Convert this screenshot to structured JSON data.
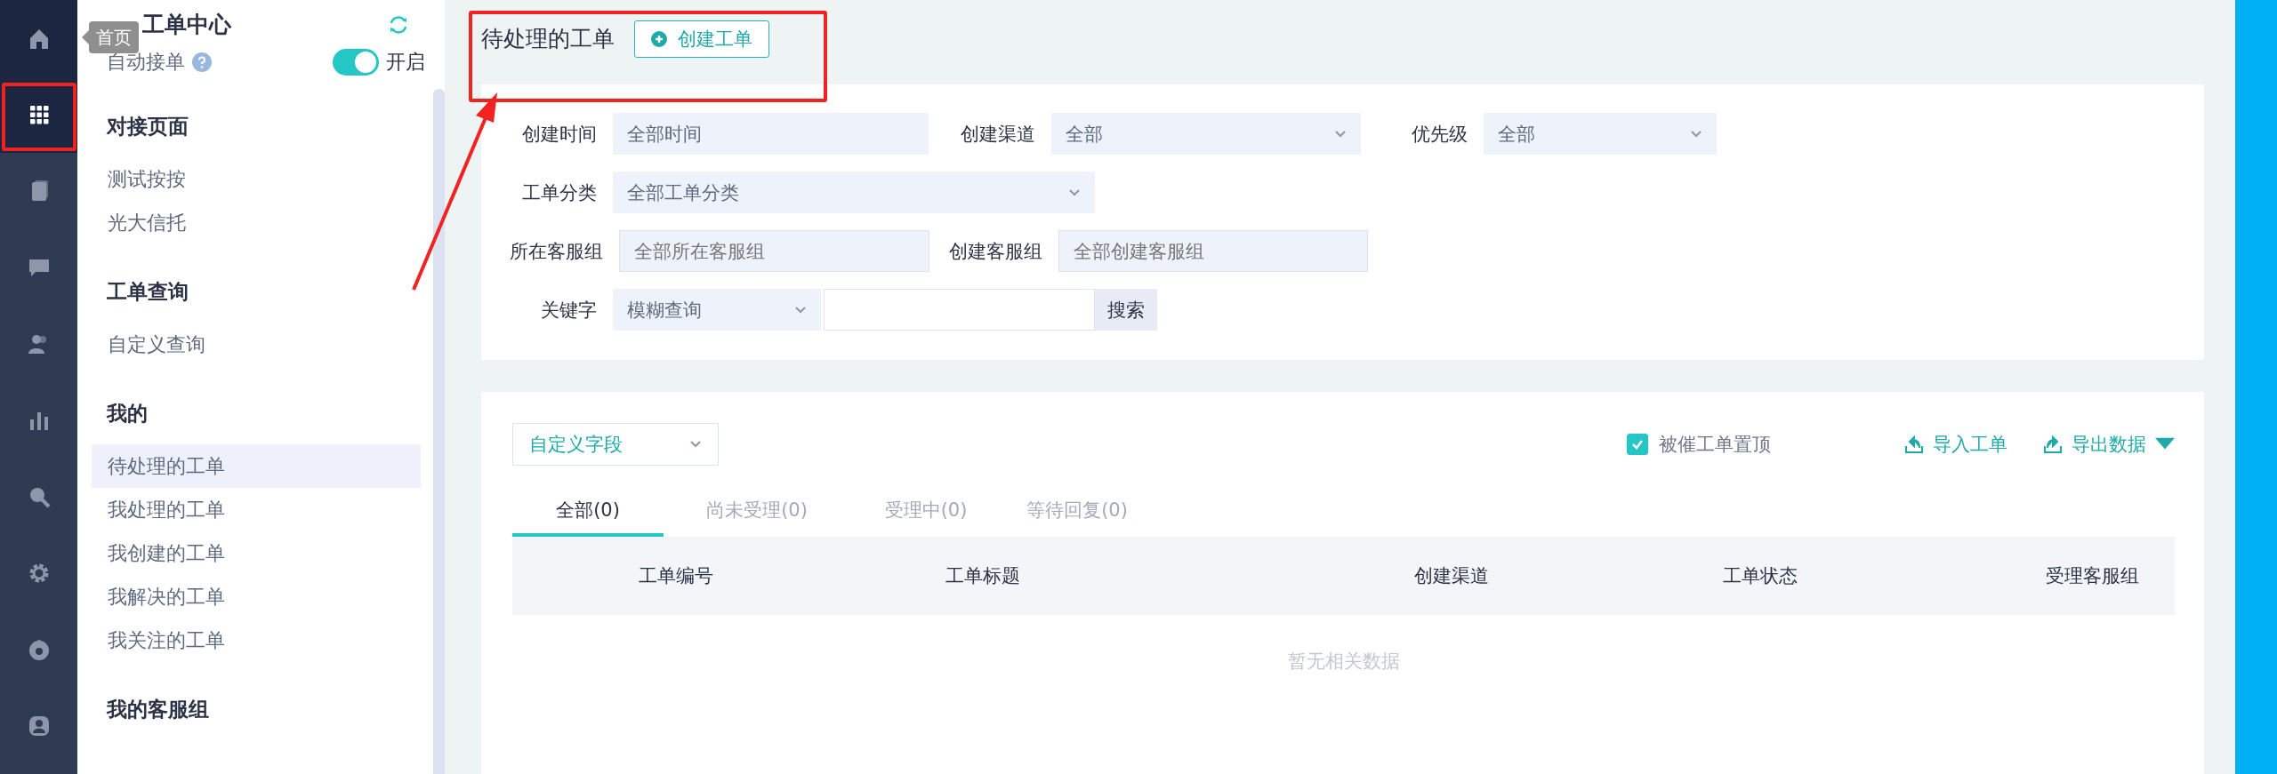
{
  "nav": {
    "items": [
      {
        "kind": "home",
        "selected": false
      },
      {
        "kind": "grid",
        "selected": true
      },
      {
        "kind": "book",
        "selected": false
      },
      {
        "kind": "chat",
        "selected": false
      },
      {
        "kind": "users",
        "selected": false
      },
      {
        "kind": "chart",
        "selected": false
      },
      {
        "kind": "search",
        "selected": false
      },
      {
        "kind": "gear",
        "selected": false
      },
      {
        "kind": "camera",
        "selected": false
      },
      {
        "kind": "user",
        "selected": false
      }
    ],
    "tooltip": "首页"
  },
  "sidebar": {
    "title": "工单中心",
    "auto_accept": {
      "label": "自动接单",
      "toggle_on": true,
      "toggle_label": "开启"
    },
    "sections": [
      {
        "title": "对接页面",
        "items": [
          {
            "label": "测试按按",
            "selected": false
          },
          {
            "label": "光大信托",
            "selected": false
          }
        ]
      },
      {
        "title": "工单查询",
        "items": [
          {
            "label": "自定义查询",
            "selected": false
          }
        ]
      },
      {
        "title": "我的",
        "items": [
          {
            "label": "待处理的工单",
            "selected": true
          },
          {
            "label": "我处理的工单",
            "selected": false
          },
          {
            "label": "我创建的工单",
            "selected": false
          },
          {
            "label": "我解决的工单",
            "selected": false
          },
          {
            "label": "我关注的工单",
            "selected": false
          }
        ]
      },
      {
        "title": "我的客服组"
      }
    ]
  },
  "header": {
    "title": "待处理的工单",
    "create_button": "创建工单"
  },
  "filters": [
    [
      {
        "label": "创建时间",
        "kind": "text",
        "value": "全部时间"
      },
      {
        "label": "创建渠道",
        "kind": "select",
        "value": "全部"
      },
      {
        "label": "优先级",
        "kind": "select",
        "value": "全部"
      }
    ],
    [
      {
        "label": "工单分类",
        "kind": "select",
        "value": "全部工单分类"
      }
    ],
    [
      {
        "label": "所在客服组",
        "kind": "input",
        "placeholder": "全部所在客服组"
      },
      {
        "label": "创建客服组",
        "kind": "input",
        "placeholder": "全部创建客服组"
      }
    ],
    [
      {
        "label": "关键字",
        "kind": "keyword",
        "value": "模糊查询",
        "button": "搜索"
      }
    ]
  ],
  "list": {
    "custom_fields": "自定义字段",
    "urged_top": {
      "label": "被催工单置顶",
      "checked": true
    },
    "actions": [
      {
        "kind": "import",
        "label": "导入工单"
      },
      {
        "kind": "export",
        "label": "导出数据"
      }
    ],
    "tabs": [
      {
        "label": "全部(0)",
        "selected": true
      },
      {
        "label": "尚未受理(0)",
        "selected": false
      },
      {
        "label": "受理中(0)",
        "selected": false
      },
      {
        "label": "等待回复(0)",
        "selected": false
      }
    ],
    "columns": [
      "工单编号",
      "工单标题",
      "创建渠道",
      "工单状态",
      "受理客服组"
    ],
    "empty_text": "暂无相关数据"
  }
}
